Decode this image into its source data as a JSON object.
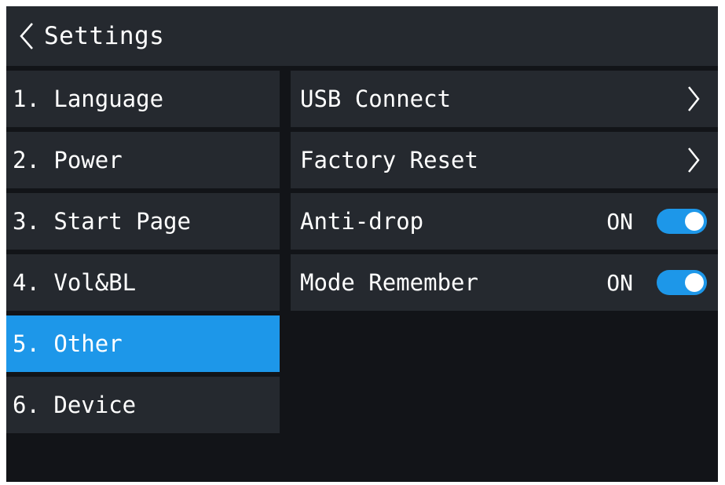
{
  "header": {
    "title": "Settings"
  },
  "colors": {
    "accent": "#1d97e9",
    "panel": "#25292f",
    "background": "#121418",
    "text": "#ffffff"
  },
  "sidebar": {
    "items": [
      {
        "label": "1. Language",
        "active": false
      },
      {
        "label": "2. Power",
        "active": false
      },
      {
        "label": "3. Start Page",
        "active": false
      },
      {
        "label": "4. Vol&BL",
        "active": false
      },
      {
        "label": "5. Other",
        "active": true
      },
      {
        "label": "6. Device",
        "active": false
      }
    ]
  },
  "content": {
    "rows": [
      {
        "label": "USB Connect",
        "type": "link",
        "icon": "chevron-right-icon"
      },
      {
        "label": "Factory Reset",
        "type": "link",
        "icon": "chevron-right-icon"
      },
      {
        "label": "Anti-drop",
        "type": "toggle",
        "state": "ON",
        "enabled": true
      },
      {
        "label": "Mode Remember",
        "type": "toggle",
        "state": "ON",
        "enabled": true
      }
    ]
  }
}
